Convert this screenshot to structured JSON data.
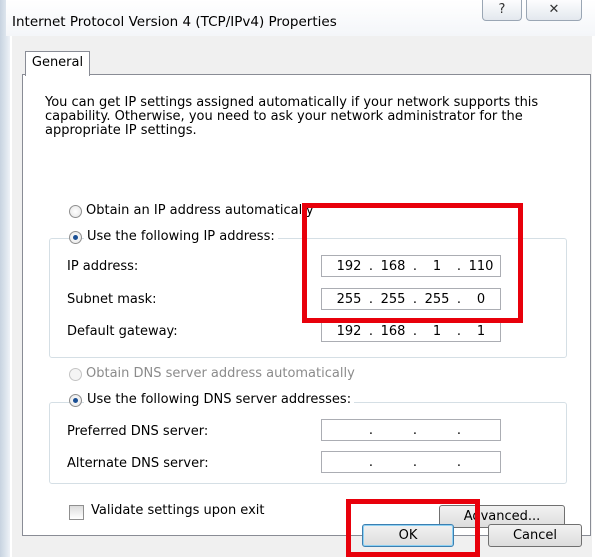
{
  "window": {
    "title": "Internet Protocol Version 4 (TCP/IPv4) Properties",
    "help_glyph": "?",
    "close_glyph": "✕"
  },
  "tabs": [
    {
      "label": "General",
      "selected": true
    }
  ],
  "intro_text": "You can get IP settings assigned automatically if your network supports this capability. Otherwise, you need to ask your network administrator for the appropriate IP settings.",
  "ip_mode": {
    "auto_label": "Obtain an IP address automatically",
    "manual_label": "Use the following IP address:",
    "selected": "manual"
  },
  "ip_fields": [
    {
      "label": "IP address:",
      "octets": [
        "192",
        "168",
        "1",
        "110"
      ]
    },
    {
      "label": "Subnet mask:",
      "octets": [
        "255",
        "255",
        "255",
        "0"
      ]
    },
    {
      "label": "Default gateway:",
      "octets": [
        "192",
        "168",
        "1",
        "1"
      ]
    }
  ],
  "dns_mode": {
    "auto_label": "Obtain DNS server address automatically",
    "auto_disabled": true,
    "manual_label": "Use the following DNS server addresses:",
    "selected": "manual"
  },
  "dns_fields": [
    {
      "label": "Preferred DNS server:",
      "octets": [
        "",
        "",
        "",
        ""
      ]
    },
    {
      "label": "Alternate DNS server:",
      "octets": [
        "",
        "",
        "",
        ""
      ]
    }
  ],
  "validate": {
    "label": "Validate settings upon exit",
    "checked": false
  },
  "buttons": {
    "advanced": "Advanced...",
    "ok": "OK",
    "cancel": "Cancel"
  },
  "colors": {
    "highlight": "#e8000b",
    "selection_dot": "#1a4f94"
  }
}
